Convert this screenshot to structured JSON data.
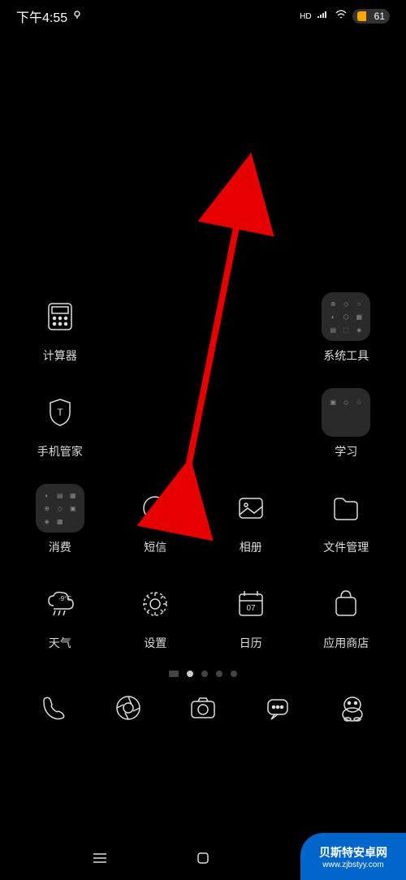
{
  "status": {
    "time": "下午4:55",
    "hd": "HD",
    "battery_pct": "61"
  },
  "apps": {
    "row1": [
      {
        "label": "计算器",
        "icon": "calculator"
      },
      null,
      null,
      {
        "label": "系统工具",
        "icon": "folder"
      }
    ],
    "row2": [
      {
        "label": "手机管家",
        "icon": "shield"
      },
      null,
      null,
      {
        "label": "学习",
        "icon": "folder"
      }
    ],
    "row3": [
      {
        "label": "消费",
        "icon": "folder"
      },
      {
        "label": "短信",
        "icon": "message"
      },
      {
        "label": "相册",
        "icon": "gallery"
      },
      {
        "label": "文件管理",
        "icon": "files"
      }
    ],
    "row4": [
      {
        "label": "天气",
        "icon": "weather"
      },
      {
        "label": "设置",
        "icon": "settings"
      },
      {
        "label": "日历",
        "icon": "calendar",
        "badge": "07"
      },
      {
        "label": "应用商店",
        "icon": "store"
      }
    ]
  },
  "dock": [
    {
      "icon": "phone"
    },
    {
      "icon": "browser"
    },
    {
      "icon": "camera"
    },
    {
      "icon": "chat"
    },
    {
      "icon": "qq"
    }
  ],
  "page_indicator": {
    "total": 5,
    "active": 1
  },
  "watermark": {
    "main": "贝斯特安卓网",
    "url": "www.zjbstyy.com"
  }
}
